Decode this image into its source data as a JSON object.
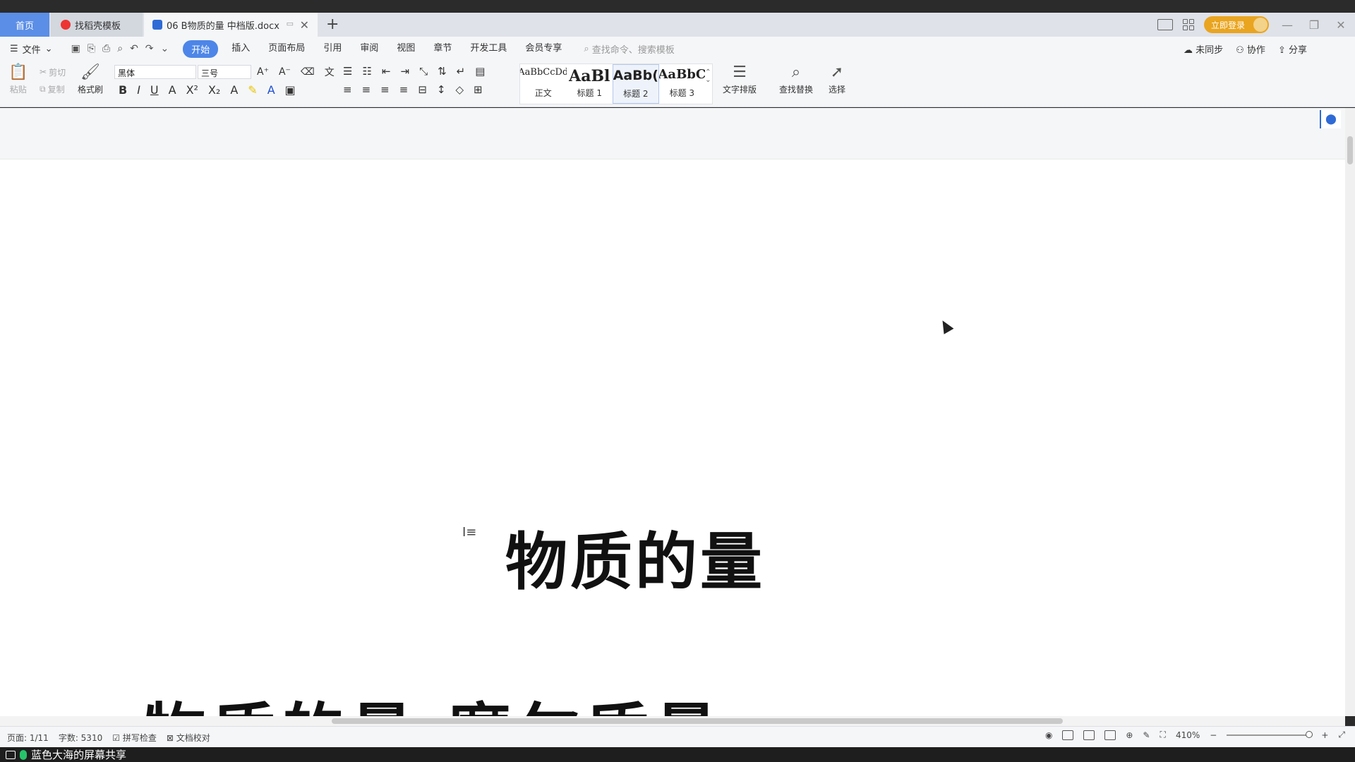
{
  "tabs": {
    "home": "首页",
    "template": "找稻壳模板",
    "document": "06 B物质的量 中档版.docx"
  },
  "top_right": {
    "login": "立即登录"
  },
  "menu": {
    "file": "文件",
    "items": [
      "开始",
      "插入",
      "页面布局",
      "引用",
      "审阅",
      "视图",
      "章节",
      "开发工具",
      "会员专享"
    ],
    "search_placeholder": "查找命令、搜索模板",
    "right": {
      "sync": "未同步",
      "collab": "协作",
      "share": "分享"
    }
  },
  "ribbon": {
    "paste": "粘贴",
    "cut": "剪切",
    "copy": "复制",
    "format_painter": "格式刷",
    "font_name": "黑体",
    "font_size": "三号",
    "styles": [
      {
        "preview": "AaBbCcDd",
        "label": "正文"
      },
      {
        "preview": "AaBl",
        "label": "标题 1"
      },
      {
        "preview": "AaBb(",
        "label": "标题 2"
      },
      {
        "preview": "AaBbC",
        "label": "标题 3"
      }
    ],
    "text_layout": "文字排版",
    "find_replace": "查找替换",
    "select": "选择"
  },
  "document": {
    "title": "物质的量",
    "heading": "一、物质的量  摩尔质量"
  },
  "status": {
    "page": "页面: 1/11",
    "words": "字数: 5310",
    "spell": "拼写检查",
    "proof": "文档校对",
    "zoom": "410%"
  },
  "share_bar": {
    "label": "蓝色大海的屏幕共享"
  }
}
